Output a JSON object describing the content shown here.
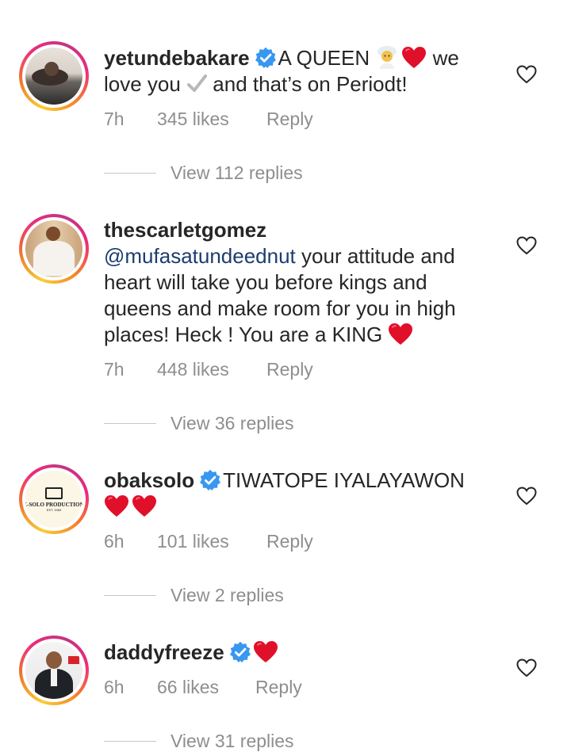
{
  "comments": [
    {
      "username": "yetundebakare",
      "verified": true,
      "text_parts": [
        "A QUEEN ",
        " we love you ",
        " and that’s on Periodt!"
      ],
      "time": "7h",
      "likes": "345 likes",
      "reply_label": "Reply",
      "view_replies": "View 112 replies"
    },
    {
      "username": "thescarletgomez",
      "verified": false,
      "mention": "@mufasatundeednut",
      "text": " your attitude and heart will take you before kings and queens and make room for you in high places! Heck ! You are a KING ",
      "time": "7h",
      "likes": "448 likes",
      "reply_label": "Reply",
      "view_replies": "View 36 replies"
    },
    {
      "username": "obaksolo",
      "verified": true,
      "text": "TIWATOPE IYALAYAWON",
      "avatar_text": "K-SOLO PRODUCTION.",
      "avatar_subtext": "EST. 1983",
      "time": "6h",
      "likes": "101 likes",
      "reply_label": "Reply",
      "view_replies": "View 2 replies"
    },
    {
      "username": "daddyfreeze",
      "verified": true,
      "time": "6h",
      "likes": "66 likes",
      "reply_label": "Reply",
      "view_replies": "View 31 replies"
    }
  ],
  "icons": {
    "like": "heart-outline-icon",
    "verified": "verified-badge-icon",
    "emoji_heart": "red-heart-emoji",
    "emoji_bride": "bride-emoji",
    "emoji_check": "check-mark-emoji"
  },
  "colors": {
    "verified": "#3897f0",
    "heart": "#e0102a",
    "muted": "#8e8e8e",
    "mention": "#1c3d6e"
  }
}
